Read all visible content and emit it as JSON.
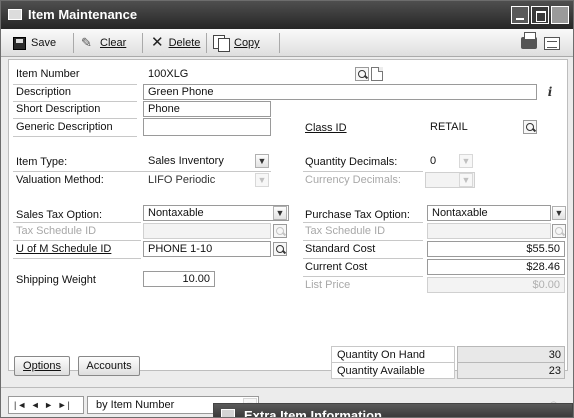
{
  "window": {
    "title": "Item Maintenance"
  },
  "toolbar": {
    "save": "Save",
    "clear": "Clear",
    "delete": "Delete",
    "copy": "Copy"
  },
  "form": {
    "item_number": {
      "label": "Item Number",
      "value": "100XLG"
    },
    "description": {
      "label": "Description",
      "value": "Green Phone"
    },
    "short_description": {
      "label": "Short Description",
      "value": "Phone"
    },
    "generic_description": {
      "label": "Generic Description",
      "value": ""
    },
    "class_id": {
      "label": "Class ID",
      "value": "RETAIL"
    },
    "item_type": {
      "label": "Item Type:",
      "value": "Sales Inventory"
    },
    "valuation_method": {
      "label": "Valuation Method:",
      "value": "LIFO Periodic"
    },
    "quantity_decimals": {
      "label": "Quantity Decimals:",
      "value": "0"
    },
    "currency_decimals": {
      "label": "Currency Decimals:",
      "value": ""
    },
    "sales_tax_option": {
      "label": "Sales Tax Option:",
      "value": "Nontaxable"
    },
    "sales_tax_schedule_id": {
      "label": "Tax Schedule ID",
      "value": ""
    },
    "uofm_schedule_id": {
      "label": "U of M Schedule ID",
      "value": "PHONE 1-10"
    },
    "shipping_weight": {
      "label": "Shipping Weight",
      "value": "10.00"
    },
    "purchase_tax_option": {
      "label": "Purchase Tax Option:",
      "value": "Nontaxable"
    },
    "purchase_tax_schedule_id": {
      "label": "Tax Schedule ID",
      "value": ""
    },
    "standard_cost": {
      "label": "Standard Cost",
      "value": "$55.50"
    },
    "current_cost": {
      "label": "Current Cost",
      "value": "$28.46"
    },
    "list_price": {
      "label": "List Price",
      "value": "$0.00"
    },
    "options_button": "Options",
    "accounts_button": "Accounts",
    "quantity_on_hand": {
      "label": "Quantity On Hand",
      "value": "30"
    },
    "quantity_available": {
      "label": "Quantity Available",
      "value": "23"
    }
  },
  "navigation": {
    "controls": "|◄ ◄ ► ►|",
    "sort_by": "by Item Number"
  },
  "popup": {
    "title": "Extra Item Information"
  }
}
